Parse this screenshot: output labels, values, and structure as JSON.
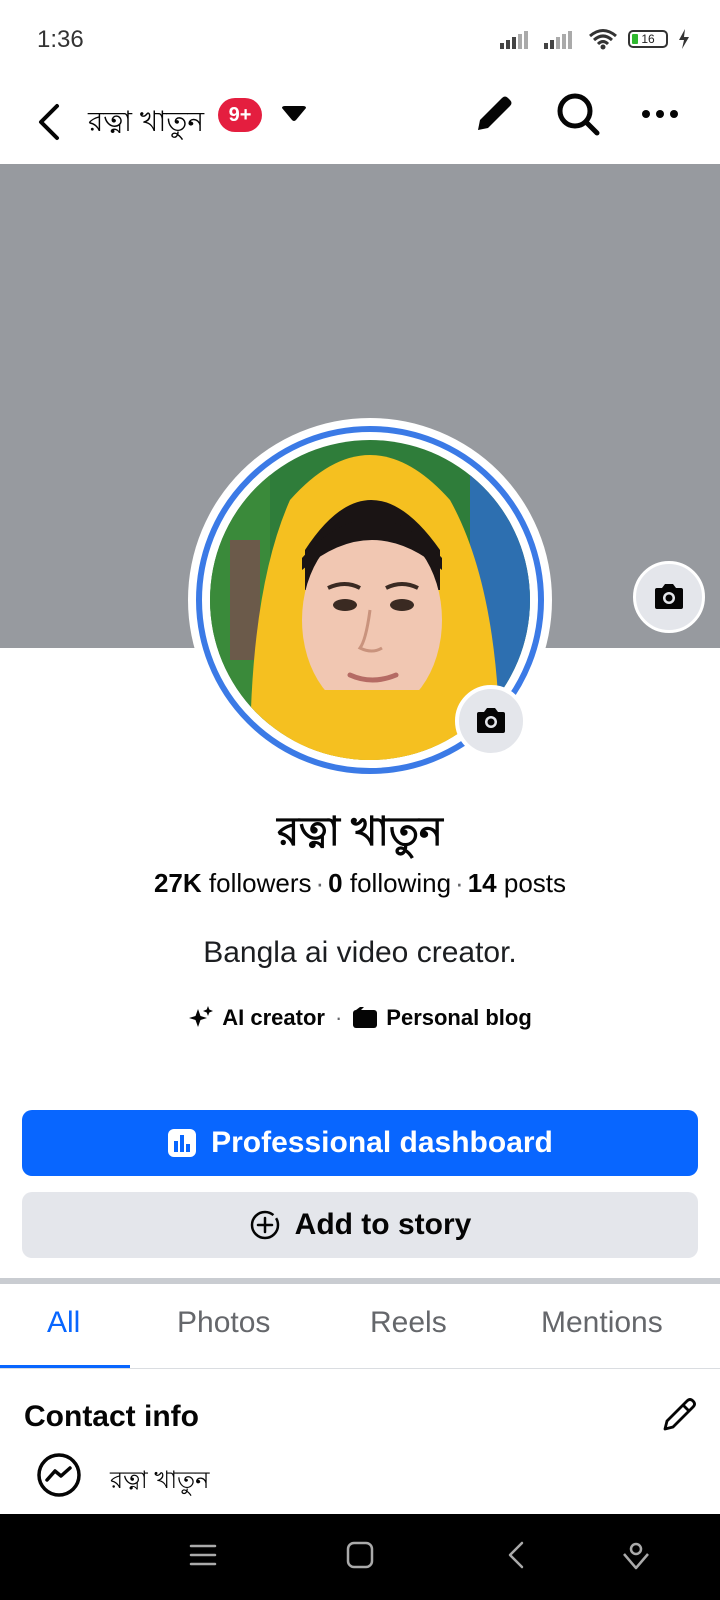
{
  "status_bar": {
    "time": "1:36",
    "battery": "16",
    "icons": [
      "signal-icon",
      "signal-icon",
      "wifi-icon",
      "battery-icon",
      "charging-icon"
    ]
  },
  "header": {
    "title": "রত্না খাতুন",
    "badge": "9+",
    "icons": [
      "back-icon",
      "caret-down-icon",
      "pencil-icon",
      "search-icon",
      "more-icon"
    ]
  },
  "profile": {
    "name": "রত্না খাতুন",
    "followers_count": "27K",
    "followers_label": "followers",
    "following_count": "0",
    "following_label": "following",
    "posts_count": "14",
    "posts_label": "posts",
    "separator": "·",
    "bio": "Bangla ai video creator.",
    "categories": [
      {
        "icon": "sparkle-icon",
        "label": "AI creator"
      },
      {
        "icon": "blog-icon",
        "label": "Personal blog"
      }
    ]
  },
  "buttons": {
    "dashboard": "Professional dashboard",
    "add_story": "Add to story"
  },
  "tabs": [
    {
      "label": "All",
      "active": true
    },
    {
      "label": "Photos",
      "active": false
    },
    {
      "label": "Reels",
      "active": false
    },
    {
      "label": "Mentions",
      "active": false
    }
  ],
  "contact_info": {
    "title": "Contact info",
    "messenger_label": "রত্না খাতুন"
  },
  "colors": {
    "accent": "#0866ff",
    "badge": "#e41e3f",
    "cover": "#979a9f",
    "secondary_button": "#e4e6eb"
  }
}
